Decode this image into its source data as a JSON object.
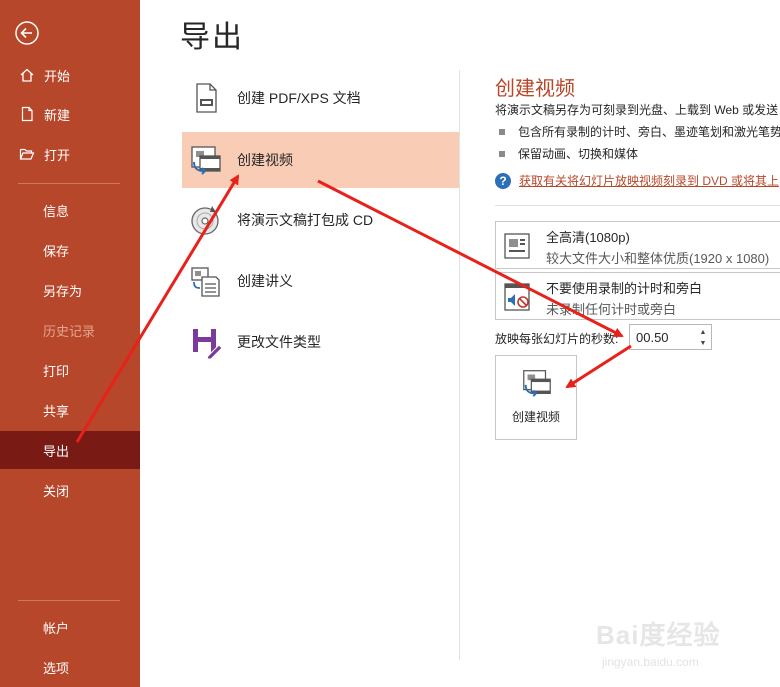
{
  "sidebar": {
    "back_icon": "arrow-left-circle-icon",
    "top_items": [
      {
        "label": "开始",
        "icon": "home-icon"
      },
      {
        "label": "新建",
        "icon": "new-document-icon"
      },
      {
        "label": "打开",
        "icon": "folder-open-icon"
      }
    ],
    "middle_items": [
      {
        "label": "信息"
      },
      {
        "label": "保存"
      },
      {
        "label": "另存为"
      },
      {
        "label": "历史记录",
        "state": "disabled"
      },
      {
        "label": "打印"
      },
      {
        "label": "共享"
      },
      {
        "label": "导出",
        "state": "active"
      },
      {
        "label": "关闭"
      }
    ],
    "bottom_items": [
      {
        "label": "帐户"
      },
      {
        "label": "选项"
      }
    ]
  },
  "page": {
    "title": "导出"
  },
  "export_options": [
    {
      "label": "创建 PDF/XPS 文档",
      "icon": "pdf-document-icon"
    },
    {
      "label": "创建视频",
      "icon": "video-icon",
      "selected": true
    },
    {
      "label": "将演示文稿打包成 CD",
      "icon": "cd-icon"
    },
    {
      "label": "创建讲义",
      "icon": "handout-icon"
    },
    {
      "label": "更改文件类型",
      "icon": "file-type-icon"
    }
  ],
  "panel": {
    "title": "创建视频",
    "description": "将演示文稿另存为可刻录到光盘、上载到 Web 或发送",
    "bullets": [
      "包含所有录制的计时、旁白、墨迹笔划和激光笔势",
      "保留动画、切换和媒体"
    ],
    "help_link": "获取有关将幻灯片放映视频刻录到 DVD 或将其上",
    "quality": {
      "title": "全高清(1080p)",
      "subtitle": "较大文件大小和整体优质(1920 x 1080)"
    },
    "timing": {
      "title": "不要使用录制的计时和旁白",
      "subtitle": "未录制任何计时或旁白"
    },
    "seconds_label": "放映每张幻灯片的秒数:",
    "seconds_value": "00.50",
    "create_button": "创建视频"
  },
  "colors": {
    "sidebar": "#b7472a",
    "sidebar_active": "#7a1a14",
    "selected_item": "#f8ccb5",
    "accent_title": "#b7472a",
    "annotation_arrow": "#e8211a"
  },
  "watermark": {
    "logo": "Bai度经验",
    "text": "jingyan.baidu.com"
  }
}
